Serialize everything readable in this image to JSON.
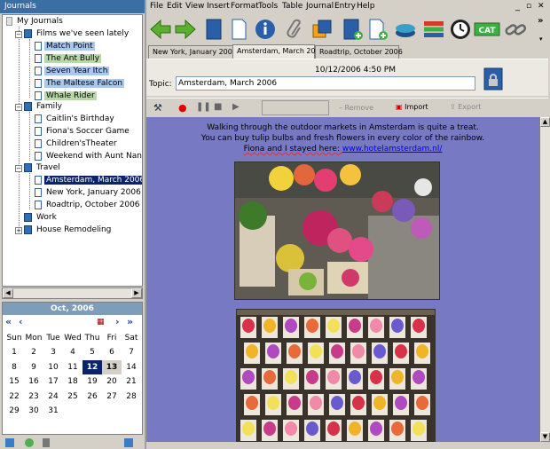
{
  "left": {
    "header": "Journals",
    "tree": {
      "root": "My Journals",
      "folders": [
        {
          "label": "Films we've seen lately",
          "items": [
            "Match Point",
            "The Ant Bully",
            "Seven Year Itch",
            "The Maltese Falcon",
            "Whale Rider"
          ]
        },
        {
          "label": "Family",
          "items": [
            "Caitlin's Birthday",
            "Fiona's Soccer Game",
            "Children'sTheater",
            "Weekend with Aunt Nancy"
          ]
        },
        {
          "label": "Travel",
          "items": [
            "Amsterdam, March 2006",
            "New York, January 2006",
            "Roadtrip, October 2006"
          ]
        },
        {
          "label": "Work",
          "items": []
        },
        {
          "label": "House Remodeling",
          "items": []
        }
      ]
    },
    "calendar": {
      "month": "Oct, 2006",
      "days_of_week": [
        "Sun",
        "Mon",
        "Tue",
        "Wed",
        "Thu",
        "Fri",
        "Sat"
      ],
      "weeks": [
        [
          "1",
          "2",
          "3",
          "4",
          "5",
          "6",
          "7"
        ],
        [
          "8",
          "9",
          "10",
          "11",
          "12",
          "13",
          "14"
        ],
        [
          "15",
          "16",
          "17",
          "18",
          "19",
          "20",
          "21"
        ],
        [
          "22",
          "23",
          "24",
          "25",
          "26",
          "27",
          "28"
        ],
        [
          "29",
          "30",
          "31",
          "",
          "",
          "",
          ""
        ]
      ],
      "today": "12",
      "selected": "13"
    }
  },
  "menu": [
    "File",
    "Edit",
    "View",
    "Insert",
    "Format",
    "Tools",
    "Table",
    "Journal",
    "Entry",
    "Help"
  ],
  "tabs": [
    "New York, January 2006",
    "Amsterdam, March 2006",
    "Roadtrip, October 2006"
  ],
  "entry": {
    "datetime": "10/12/2006 4:50 PM",
    "topic_label": "Topic:",
    "topic_value": "Amsterdam, March 2006"
  },
  "media": {
    "remove_label": "Remove",
    "import_label": "Import",
    "export_label": "Export"
  },
  "content": {
    "line1": "Walking through the outdoor markets in Amsterdam is quite a treat.",
    "line2": "You can buy tulip bulbs and fresh flowers in every color of the rainbow.",
    "line3_prefix": "Fiona and I stayed here: ",
    "link": "www.hotelamsterdam.nl/",
    "photo1": "flower market stall with potted flowers",
    "photo2": "crates of tulip bulb packets"
  },
  "toolbar": {
    "cat_label": "CAT"
  },
  "colors": {
    "content_bg": "#7779c2",
    "selection": "#0a246a",
    "header_blue": "#3a6ea5"
  }
}
